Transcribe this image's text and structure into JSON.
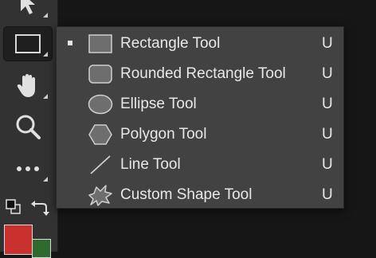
{
  "toolbar": {
    "tools": [
      {
        "name": "Move Tool",
        "icon": "arrow-cursor-icon"
      },
      {
        "name": "Rectangle Tool",
        "icon": "rectangle-icon"
      },
      {
        "name": "Hand Tool",
        "icon": "hand-icon"
      },
      {
        "name": "Zoom Tool",
        "icon": "magnifier-icon"
      },
      {
        "name": "More Tools",
        "icon": "ellipsis-icon"
      }
    ],
    "foreground_color": "#c8312e",
    "background_color": "#2f6b2e"
  },
  "flyout": {
    "items": [
      {
        "label": "Rectangle Tool",
        "shortcut": "U",
        "icon": "rectangle-icon",
        "active": true
      },
      {
        "label": "Rounded Rectangle Tool",
        "shortcut": "U",
        "icon": "rounded-rectangle-icon",
        "active": false
      },
      {
        "label": "Ellipse Tool",
        "shortcut": "U",
        "icon": "ellipse-icon",
        "active": false
      },
      {
        "label": "Polygon Tool",
        "shortcut": "U",
        "icon": "polygon-icon",
        "active": false
      },
      {
        "label": "Line Tool",
        "shortcut": "U",
        "icon": "line-icon",
        "active": false
      },
      {
        "label": "Custom Shape Tool",
        "shortcut": "U",
        "icon": "custom-shape-icon",
        "active": false
      }
    ]
  }
}
